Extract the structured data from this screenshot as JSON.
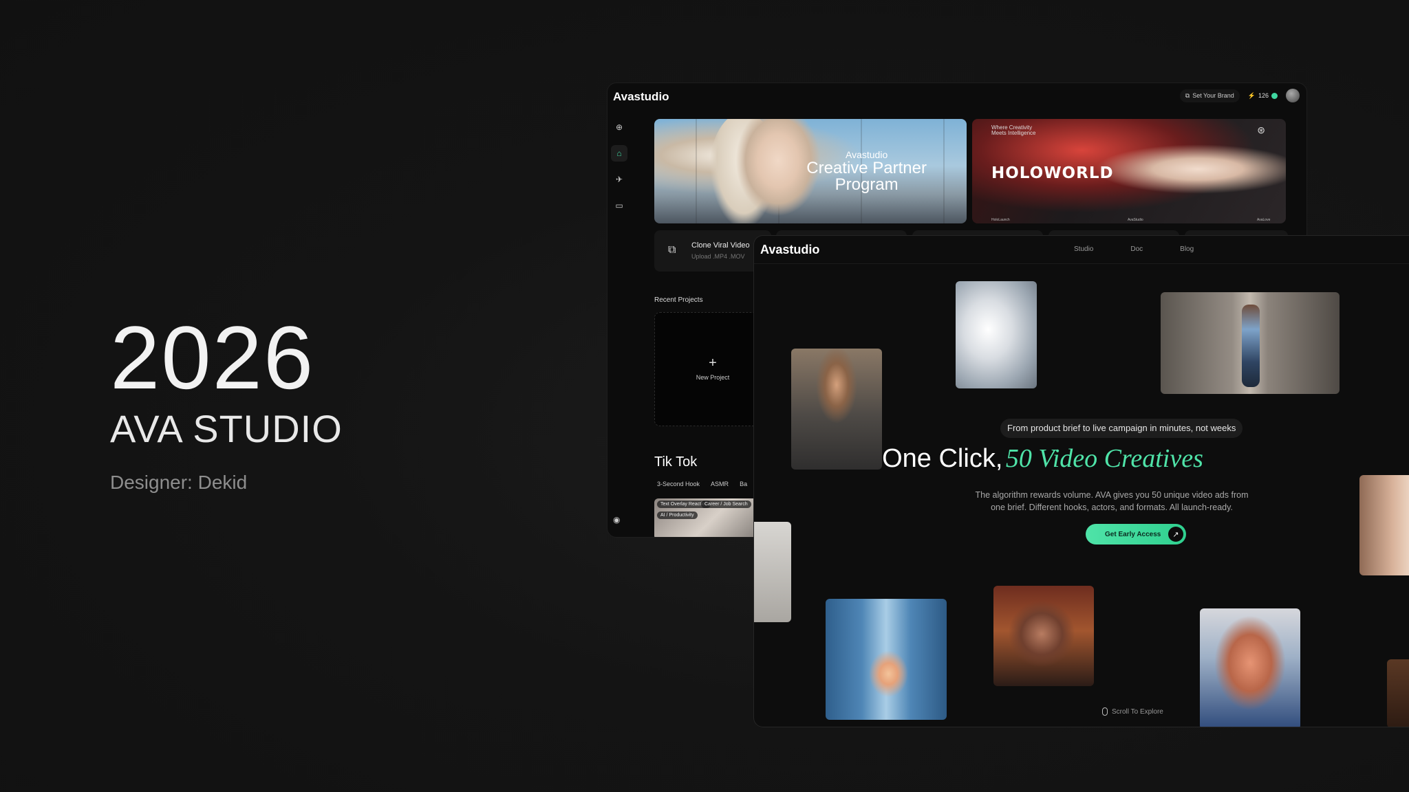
{
  "hero": {
    "year": "2026",
    "title": "AVA STUDIO",
    "designer": "Designer: Dekid"
  },
  "dashboard": {
    "logo": "Avastudio",
    "brand_button": "Set Your Brand",
    "credits": "126",
    "sidebar_icons": [
      "plus-circle-icon",
      "home-icon",
      "rocket-icon",
      "book-icon"
    ],
    "banner1": {
      "small": "Avastudio",
      "line1": "Creative Partner",
      "line2": "Program"
    },
    "banner2": {
      "tag_line1": "Where Creativity",
      "tag_line2": "Meets Intelligence",
      "title": "HOLOWORLD",
      "foot_left": "HoloLaunch",
      "foot_mid": "AvaStudio",
      "foot_right": "AvaLove"
    },
    "clone_card": {
      "title": "Clone Viral Video",
      "subtitle": "Upload .MP4 .MOV"
    },
    "recent_projects": "Recent Projects",
    "new_project": "New Project",
    "section_title": "Tik Tok",
    "tags": [
      "3-Second Hook",
      "ASMR",
      "Ba"
    ],
    "chips": [
      "Text Overlay Reaction",
      "Career / Job Search",
      "AI / Productivity"
    ]
  },
  "landing": {
    "logo": "Avastudio",
    "nav": [
      "Studio",
      "Doc",
      "Blog"
    ],
    "pill": "From product brief to live campaign in minutes, not weeks",
    "headline_white": "One Click,",
    "headline_green": "50 Video Creatives",
    "description": "The algorithm rewards volume. AVA gives you 50 unique video ads from one brief. Different hooks, actors, and formats. All launch-ready.",
    "cta": "Get Early Access",
    "scroll": "Scroll To Explore"
  },
  "colors": {
    "accent": "#4fe3a8",
    "background": "#141414"
  }
}
